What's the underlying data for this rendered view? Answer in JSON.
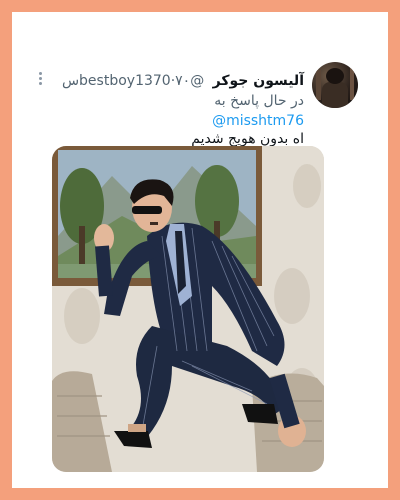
{
  "tweet": {
    "display_name": "آلیسون جوکر",
    "handle": "@bestboy1370",
    "time": "۷۰س",
    "reply_prefix": "در حال پاسخ به",
    "reply_to": "@misshtm76",
    "text": "اه بدون هویج شدیم"
  },
  "colors": {
    "page_background": "#f4a07c",
    "card": "#ffffff",
    "link": "#1d9bf0",
    "muted": "#536471"
  },
  "icons": {
    "menu": "more-vertical-icon"
  }
}
